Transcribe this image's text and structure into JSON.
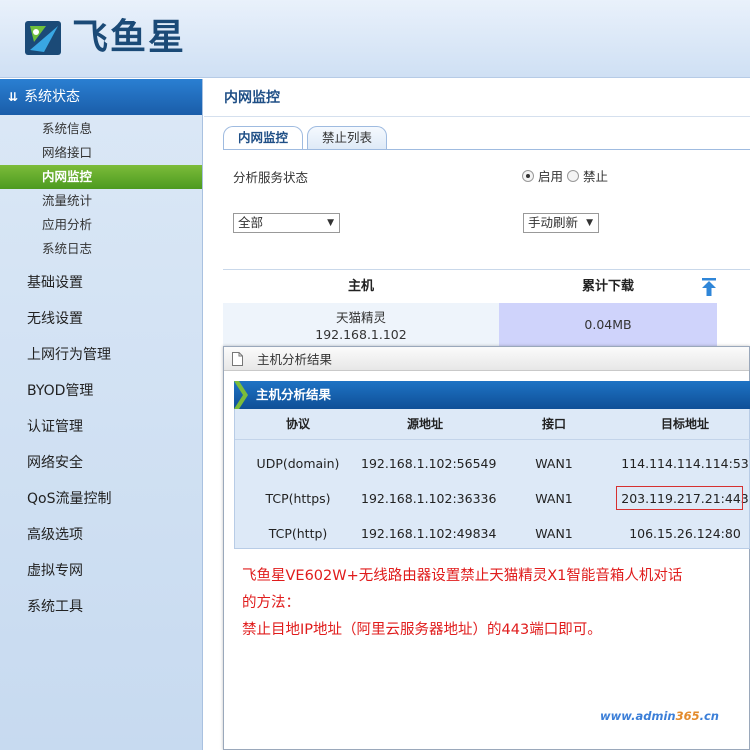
{
  "brand": {
    "name": "飞鱼星"
  },
  "sidebar": {
    "section_title": "系统状态",
    "sub_items": [
      {
        "label": "系统信息"
      },
      {
        "label": "网络接口"
      },
      {
        "label": "内网监控"
      },
      {
        "label": "流量统计"
      },
      {
        "label": "应用分析"
      },
      {
        "label": "系统日志"
      }
    ],
    "items": [
      {
        "label": "基础设置"
      },
      {
        "label": "无线设置"
      },
      {
        "label": "上网行为管理"
      },
      {
        "label": "BYOD管理"
      },
      {
        "label": "认证管理"
      },
      {
        "label": "网络安全"
      },
      {
        "label": "QoS流量控制"
      },
      {
        "label": "高级选项"
      },
      {
        "label": "虚拟专网"
      },
      {
        "label": "系统工具"
      }
    ]
  },
  "main": {
    "title": "内网监控",
    "tabs": [
      {
        "label": "内网监控"
      },
      {
        "label": "禁止列表"
      }
    ],
    "service_label": "分析服务状态",
    "radio_on": "启用",
    "radio_off": "禁止",
    "filter_select": "全部",
    "refresh_select": "手动刷新",
    "table": {
      "col_host": "主机",
      "col_download": "累计下载",
      "row": {
        "host_name": "天猫精灵",
        "host_ip": "192.168.1.102",
        "download": "0.04MB"
      }
    }
  },
  "popup": {
    "title": "主机分析结果",
    "section_title": "主机分析结果",
    "headers": {
      "protocol": "协议",
      "src": "源地址",
      "iface": "接口",
      "dst": "目标地址"
    },
    "rows": [
      {
        "protocol": "UDP(domain)",
        "src": "192.168.1.102:56549",
        "iface": "WAN1",
        "dst": "114.114.114.114:53"
      },
      {
        "protocol": "TCP(https)",
        "src": "192.168.1.102:36336",
        "iface": "WAN1",
        "dst": "203.119.217.21:443"
      },
      {
        "protocol": "TCP(http)",
        "src": "192.168.1.102:49834",
        "iface": "WAN1",
        "dst": "106.15.26.124:80"
      }
    ],
    "note_line1": "飞鱼星VE602W+无线路由器设置禁止天猫精灵X1智能音箱人机对话",
    "note_line2": "的方法：",
    "note_line3": "禁止目地IP地址（阿里云服务器地址）的443端口即可。"
  },
  "watermark": {
    "prefix": "www.admin",
    "number": "365",
    "suffix": ".cn"
  },
  "colors": {
    "accent": "#1a5da9",
    "active_green": "#4c9a1f",
    "note_red": "#e01c1c"
  }
}
